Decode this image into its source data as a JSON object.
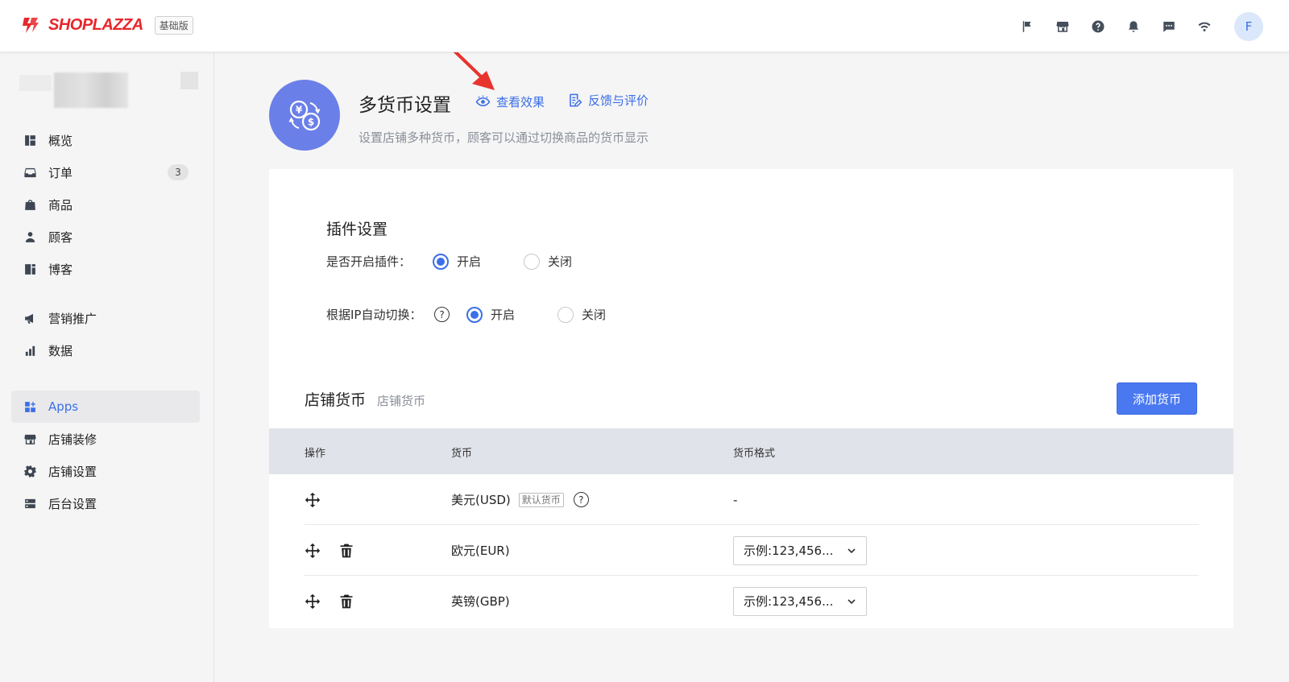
{
  "header": {
    "brand": "SHOPLAZZA",
    "plan": "基础版",
    "avatar_initial": "F",
    "icons": [
      "flag-icon",
      "store-icon",
      "help-icon",
      "bell-icon",
      "chat-icon",
      "wifi-icon"
    ]
  },
  "sidebar": {
    "groups": [
      [
        {
          "label": "概览",
          "icon": "dashboard-icon"
        },
        {
          "label": "订单",
          "icon": "inbox-icon",
          "badge": "3"
        },
        {
          "label": "商品",
          "icon": "bag-icon"
        },
        {
          "label": "顾客",
          "icon": "person-icon"
        },
        {
          "label": "博客",
          "icon": "blog-icon"
        }
      ],
      [
        {
          "label": "营销推广",
          "icon": "megaphone-icon"
        },
        {
          "label": "数据",
          "icon": "bar-chart-icon"
        }
      ],
      [
        {
          "label": "Apps",
          "icon": "apps-icon",
          "active": true
        },
        {
          "label": "店铺装修",
          "icon": "store-icon"
        },
        {
          "label": "店铺设置",
          "icon": "gear-icon"
        },
        {
          "label": "后台设置",
          "icon": "server-icon"
        }
      ]
    ]
  },
  "page": {
    "title": "多货币设置",
    "view_effect_link": "查看效果",
    "feedback_link": "反馈与评价",
    "description": "设置店铺多种货币，顾客可以通过切换商品的货币显示"
  },
  "plugin_settings": {
    "title": "插件设置",
    "enable_label": "是否开启插件：",
    "auto_switch_label": "根据IP自动切换：",
    "on_label": "开启",
    "off_label": "关闭",
    "enable_value": "开启",
    "auto_switch_value": "开启"
  },
  "store_currency": {
    "title": "店铺货币",
    "subtitle": "店铺货币",
    "add_button": "添加货币",
    "columns": [
      "操作",
      "货币",
      "货币格式"
    ],
    "rows": [
      {
        "currency": "美元(USD)",
        "default_tag": "默认货币",
        "format": "-",
        "deletable": false
      },
      {
        "currency": "欧元(EUR)",
        "format": "示例:123,456...",
        "deletable": true
      },
      {
        "currency": "英镑(GBP)",
        "format": "示例:123,456...",
        "deletable": true
      }
    ]
  },
  "colors": {
    "accent": "#3b6ee8",
    "brand": "#e8262b",
    "app_logo_bg": "#6b7fe8",
    "table_header_bg": "#e1e3ea",
    "annotation_arrow": "#e8342c"
  }
}
